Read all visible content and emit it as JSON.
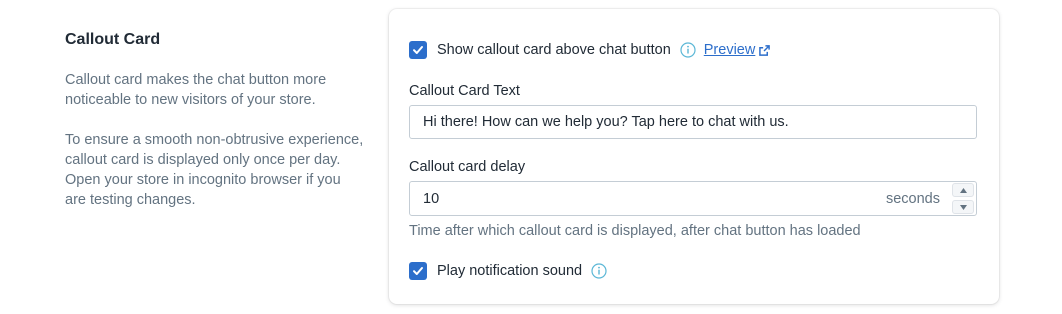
{
  "section": {
    "title": "Callout Card",
    "description_1": "Callout card makes the chat button more noticeable to new visitors of your store.",
    "description_2": "To ensure a smooth non-obtrusive experience, callout card is displayed only once per day. Open your store in incognito browser if you are testing changes."
  },
  "form": {
    "show_callout": {
      "label": "Show callout card above chat button",
      "checked": true,
      "preview_label": "Preview"
    },
    "callout_text": {
      "label": "Callout Card Text",
      "value": "Hi there! How can we help you? Tap here to chat with us."
    },
    "delay": {
      "label": "Callout card delay",
      "value": "10",
      "suffix": "seconds",
      "help": "Time after which callout card is displayed, after chat button has loaded"
    },
    "sound": {
      "label": "Play notification sound",
      "checked": true
    }
  },
  "colors": {
    "accent": "#2c6ecb",
    "info_icon": "#5bb7d6",
    "muted_text": "#637381"
  },
  "icons": {
    "checkbox": "checkmark-icon",
    "info": "info-circle-icon",
    "external": "external-link-icon",
    "step_up": "chevron-up-icon",
    "step_down": "chevron-down-icon"
  }
}
